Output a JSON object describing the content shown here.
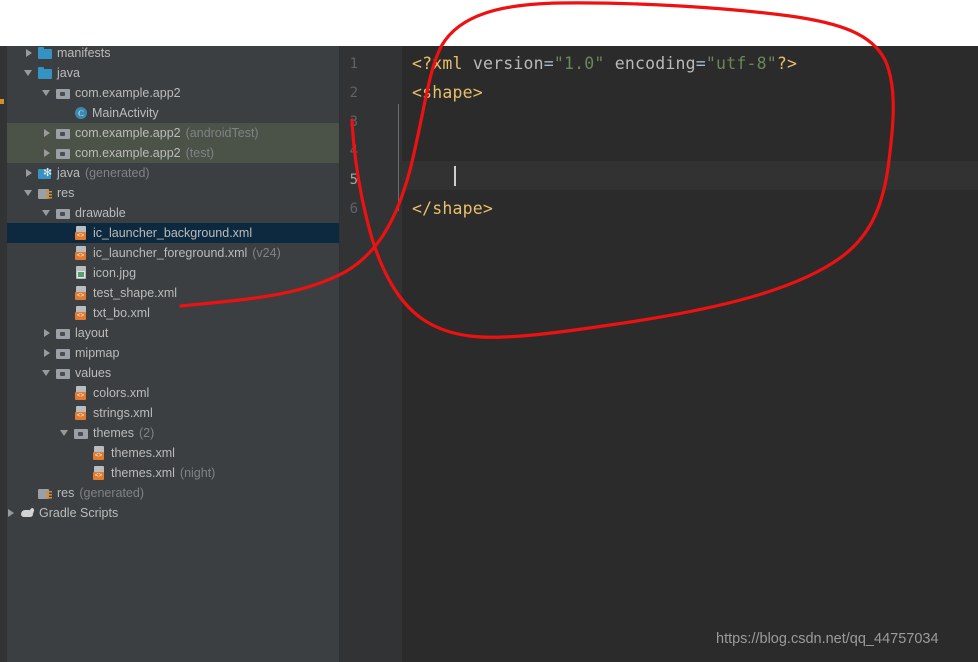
{
  "window": {
    "theme": "darcula",
    "accent_selected_row": "#0d293f",
    "accent_test_source_row": "#4b5247",
    "tree_background": "#3c3f41",
    "editor_background": "#2b2b2b",
    "gutter_background": "#313335"
  },
  "project_tree": {
    "rows": [
      {
        "label": "manifests",
        "suffix": "",
        "indent": 1,
        "toggle": "right",
        "icon": "folder-blue-icon",
        "state": "normal",
        "name": "tree-item-manifests"
      },
      {
        "label": "java",
        "suffix": "",
        "indent": 1,
        "toggle": "down",
        "icon": "folder-blue-icon",
        "state": "normal",
        "name": "tree-item-java"
      },
      {
        "label": "com.example.app2",
        "suffix": "",
        "indent": 2,
        "toggle": "down",
        "icon": "folder-gray-icon",
        "state": "normal",
        "name": "tree-item-package-main"
      },
      {
        "label": "MainActivity",
        "suffix": "",
        "indent": 3,
        "toggle": "none",
        "icon": "java-class-icon",
        "state": "normal",
        "name": "tree-item-mainactivity"
      },
      {
        "label": "com.example.app2",
        "suffix": "(androidTest)",
        "indent": 2,
        "toggle": "right",
        "icon": "folder-gray-icon",
        "state": "testsrc",
        "name": "tree-item-package-androidtest"
      },
      {
        "label": "com.example.app2",
        "suffix": "(test)",
        "indent": 2,
        "toggle": "right",
        "icon": "folder-gray-icon",
        "state": "testsrc",
        "name": "tree-item-package-test"
      },
      {
        "label": "java",
        "suffix": "(generated)",
        "indent": 1,
        "toggle": "right",
        "icon": "folder-generated-icon",
        "state": "normal",
        "name": "tree-item-java-generated"
      },
      {
        "label": "res",
        "suffix": "",
        "indent": 1,
        "toggle": "down",
        "icon": "folder-res-icon",
        "state": "normal",
        "name": "tree-item-res"
      },
      {
        "label": "drawable",
        "suffix": "",
        "indent": 2,
        "toggle": "down",
        "icon": "folder-gray-icon",
        "state": "normal",
        "name": "tree-item-drawable"
      },
      {
        "label": "ic_launcher_background.xml",
        "suffix": "",
        "indent": 3,
        "toggle": "none",
        "icon": "xml-file-icon",
        "state": "selected",
        "name": "tree-item-ic-launcher-background"
      },
      {
        "label": "ic_launcher_foreground.xml",
        "suffix": "(v24)",
        "indent": 3,
        "toggle": "none",
        "icon": "xml-file-icon",
        "state": "normal",
        "name": "tree-item-ic-launcher-foreground"
      },
      {
        "label": "icon.jpg",
        "suffix": "",
        "indent": 3,
        "toggle": "none",
        "icon": "image-file-icon",
        "state": "normal",
        "name": "tree-item-icon-jpg"
      },
      {
        "label": "test_shape.xml",
        "suffix": "",
        "indent": 3,
        "toggle": "none",
        "icon": "xml-file-icon",
        "state": "normal",
        "name": "tree-item-test-shape"
      },
      {
        "label": "txt_bo.xml",
        "suffix": "",
        "indent": 3,
        "toggle": "none",
        "icon": "xml-file-icon",
        "state": "normal",
        "name": "tree-item-txt-bo"
      },
      {
        "label": "layout",
        "suffix": "",
        "indent": 2,
        "toggle": "right",
        "icon": "folder-gray-icon",
        "state": "normal",
        "name": "tree-item-layout"
      },
      {
        "label": "mipmap",
        "suffix": "",
        "indent": 2,
        "toggle": "right",
        "icon": "folder-gray-icon",
        "state": "normal",
        "name": "tree-item-mipmap"
      },
      {
        "label": "values",
        "suffix": "",
        "indent": 2,
        "toggle": "down",
        "icon": "folder-gray-icon",
        "state": "normal",
        "name": "tree-item-values"
      },
      {
        "label": "colors.xml",
        "suffix": "",
        "indent": 3,
        "toggle": "none",
        "icon": "xml-file-icon",
        "state": "normal",
        "name": "tree-item-colors"
      },
      {
        "label": "strings.xml",
        "suffix": "",
        "indent": 3,
        "toggle": "none",
        "icon": "xml-file-icon",
        "state": "normal",
        "name": "tree-item-strings"
      },
      {
        "label": "themes",
        "suffix": "(2)",
        "indent": 3,
        "toggle": "down",
        "icon": "folder-gray-icon",
        "state": "normal",
        "name": "tree-item-themes-folder"
      },
      {
        "label": "themes.xml",
        "suffix": "",
        "indent": 4,
        "toggle": "none",
        "icon": "xml-file-icon",
        "state": "normal",
        "name": "tree-item-themes"
      },
      {
        "label": "themes.xml",
        "suffix": "(night)",
        "indent": 4,
        "toggle": "none",
        "icon": "xml-file-icon",
        "state": "normal",
        "name": "tree-item-themes-night"
      },
      {
        "label": "res",
        "suffix": "(generated)",
        "indent": 1,
        "toggle": "none",
        "icon": "folder-res-icon",
        "state": "normal",
        "name": "tree-item-res-generated"
      },
      {
        "label": "Gradle Scripts",
        "suffix": "",
        "indent": 0,
        "toggle": "right",
        "icon": "gradle-icon",
        "state": "normal",
        "name": "tree-item-gradle-scripts"
      }
    ]
  },
  "editor": {
    "line_numbers": [
      "1",
      "2",
      "3",
      "4",
      "5",
      "6"
    ],
    "active_line": "5",
    "lines": [
      {
        "n": 1,
        "tokens": [
          {
            "t": "<?xml ",
            "c": "tag"
          },
          {
            "t": "version",
            "c": "attr"
          },
          {
            "t": "=",
            "c": "plain"
          },
          {
            "t": "\"1.0\"",
            "c": "str"
          },
          {
            "t": " ",
            "c": "plain"
          },
          {
            "t": "encoding",
            "c": "attr"
          },
          {
            "t": "=",
            "c": "plain"
          },
          {
            "t": "\"utf-8\"",
            "c": "str"
          },
          {
            "t": "?>",
            "c": "tag"
          }
        ]
      },
      {
        "n": 2,
        "tokens": [
          {
            "t": "<shape>",
            "c": "tag"
          }
        ]
      },
      {
        "n": 3,
        "tokens": []
      },
      {
        "n": 4,
        "tokens": []
      },
      {
        "n": 5,
        "tokens": []
      },
      {
        "n": 6,
        "tokens": [
          {
            "t": "</shape>",
            "c": "tag"
          }
        ]
      }
    ],
    "plain_text": "<?xml version=\"1.0\" encoding=\"utf-8\"?>\n<shape>\n\n\n\n</shape>",
    "fold_markers": [
      {
        "line": 2,
        "type": "fold-open-start"
      },
      {
        "line": 6,
        "type": "fold-open-end"
      }
    ],
    "syntax_colors": {
      "tag": "#e8bf6a",
      "attribute": "#bababa",
      "string": "#6a8759",
      "plain": "#a9b7c6",
      "line_number": "#606366",
      "line_number_active": "#a4a3a3"
    }
  },
  "annotation": {
    "type": "freehand-circle",
    "color": "#ee1111",
    "stroke_width": 3,
    "description": "red hand-drawn loop around the XML editor content pointing to test_shape.xml"
  },
  "watermark": {
    "text": "https://blog.csdn.net/qq_44757034"
  }
}
